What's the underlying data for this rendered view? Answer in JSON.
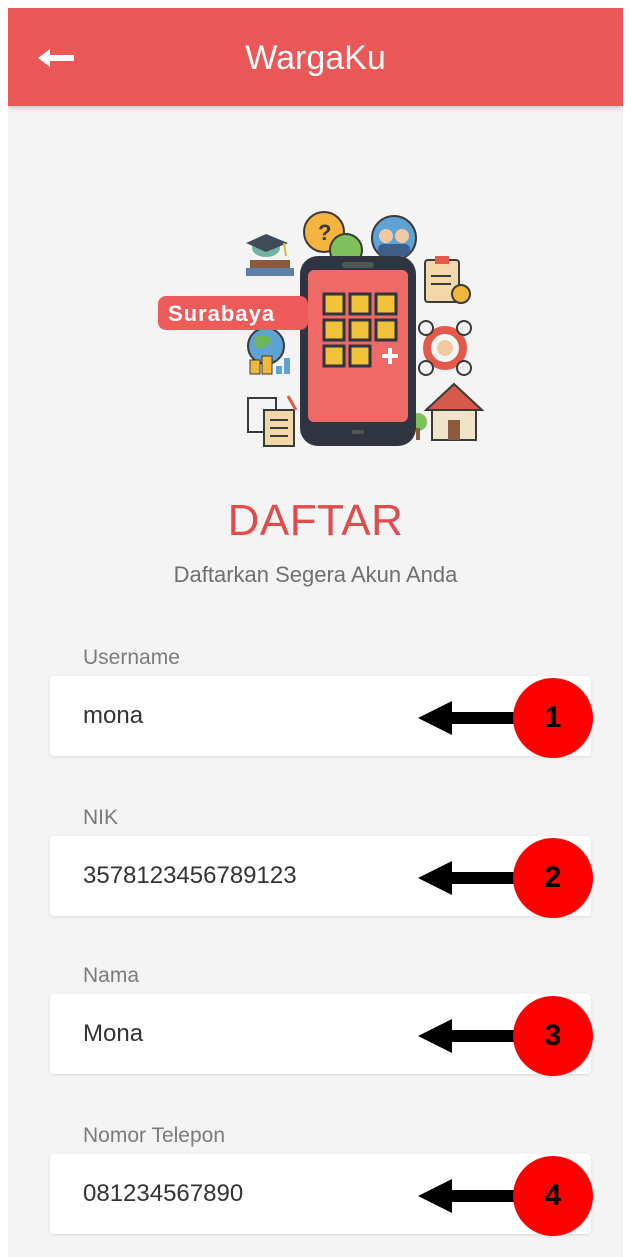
{
  "appbar": {
    "title": "WargaKu",
    "back_icon": "arrow-left-icon"
  },
  "hero": {
    "city_label": "Surabaya",
    "icon": "smartphone-city-services-illustration"
  },
  "page": {
    "heading": "DAFTAR",
    "subheading": "Daftarkan Segera Akun Anda"
  },
  "form": {
    "fields": [
      {
        "label": "Username",
        "value": "mona",
        "marker": "1"
      },
      {
        "label": "NIK",
        "value": "3578123456789123",
        "marker": "2"
      },
      {
        "label": "Nama",
        "value": "Mona",
        "marker": "3"
      },
      {
        "label": "Nomor Telepon",
        "value": "081234567890",
        "marker": "4"
      }
    ]
  },
  "colors": {
    "brand": "#ea5757",
    "heading": "#e04b4b",
    "marker": "#ff0000"
  }
}
